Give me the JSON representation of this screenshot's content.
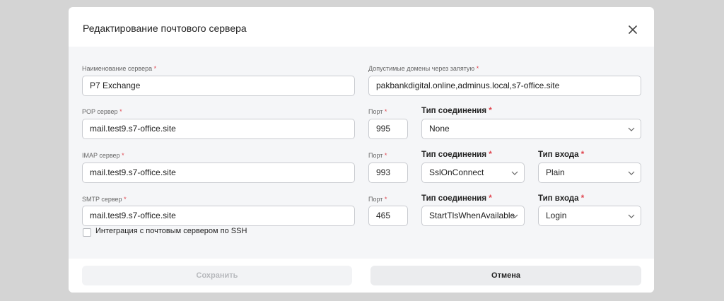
{
  "dialog": {
    "title": "Редактирование почтового сервера"
  },
  "form": {
    "server_name": {
      "label": "Наименование сервера",
      "value": "P7 Exchange"
    },
    "domains": {
      "label": "Допустимые домены через запятую",
      "value": "pakbankdigital.online,adminus.local,s7-office.site"
    },
    "pop": {
      "label": "POP сервер",
      "value": "mail.test9.s7-office.site",
      "port_label": "Порт",
      "port": "995",
      "conn_label": "Тип соединения",
      "conn": "None"
    },
    "imap": {
      "label": "IMAP сервер",
      "value": "mail.test9.s7-office.site",
      "port_label": "Порт",
      "port": "993",
      "conn_label": "Тип соединения",
      "conn": "SslOnConnect",
      "login_label": "Тип входа",
      "login": "Plain"
    },
    "smtp": {
      "label": "SMTP сервер",
      "value": "mail.test9.s7-office.site",
      "port_label": "Порт",
      "port": "465",
      "conn_label": "Тип соединения",
      "conn": "StartTlsWhenAvailable",
      "login_label": "Тип входа",
      "login": "Login"
    },
    "ssh": {
      "label": "Интеграция с почтовым сервером по SSH",
      "checked": false
    },
    "required_mark": "*"
  },
  "footer": {
    "save_label": "Сохранить",
    "cancel_label": "Отмена"
  },
  "icons": {
    "close": "close-icon",
    "chevron": "chevron-down-icon"
  },
  "colors": {
    "required": "#e0454f",
    "overlay": "#d4d4d4",
    "body_bg": "#f5f6f8"
  }
}
